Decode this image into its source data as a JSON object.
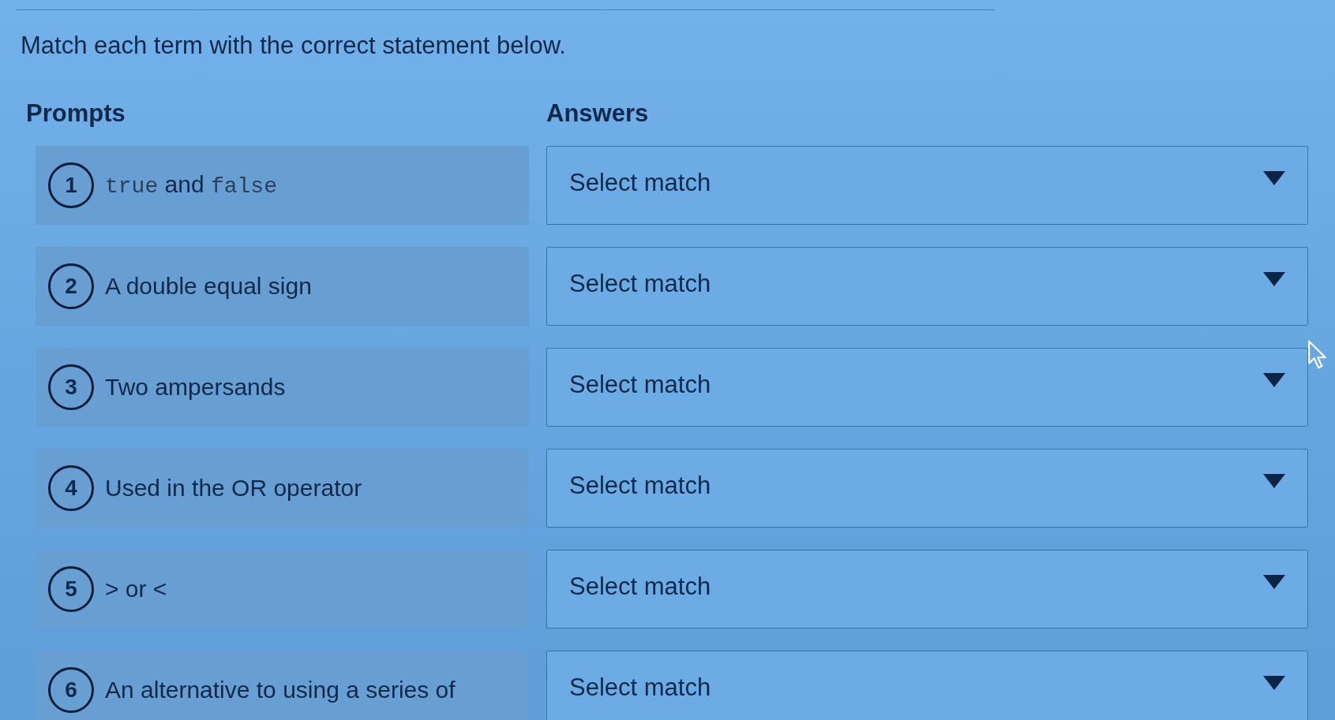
{
  "instruction": "Match each term with the correct statement below.",
  "prompts_heading": "Prompts",
  "answers_heading": "Answers",
  "pairs": [
    {
      "number": "1",
      "prompt": [
        {
          "kind": "code",
          "text": "true"
        },
        {
          "kind": "plain",
          "text": " and "
        },
        {
          "kind": "code",
          "text": "false"
        }
      ],
      "answer": {
        "placeholder": "Select match"
      }
    },
    {
      "number": "2",
      "prompt": [
        {
          "kind": "plain",
          "text": "A double equal sign"
        }
      ],
      "answer": {
        "placeholder": "Select match"
      }
    },
    {
      "number": "3",
      "prompt": [
        {
          "kind": "plain",
          "text": "Two ampersands"
        }
      ],
      "answer": {
        "placeholder": "Select match"
      }
    },
    {
      "number": "4",
      "prompt": [
        {
          "kind": "plain",
          "text": "Used in the OR operator"
        }
      ],
      "answer": {
        "placeholder": "Select match"
      }
    },
    {
      "number": "5",
      "prompt": [
        {
          "kind": "plain",
          "text": "> or <"
        }
      ],
      "answer": {
        "placeholder": "Select match"
      }
    },
    {
      "number": "6",
      "prompt": [
        {
          "kind": "plain",
          "text": "An alternative to using a series of"
        }
      ],
      "answer": {
        "placeholder": "Select match"
      }
    }
  ]
}
